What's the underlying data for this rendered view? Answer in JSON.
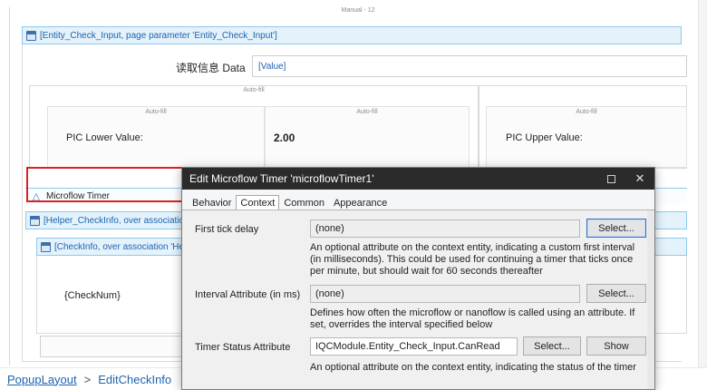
{
  "page": {
    "header": "Manual - 12",
    "dataview_title": "[Entity_Check_Input, page parameter 'Entity_Check_Input']",
    "read_info_label": "读取信息 Data",
    "read_info_value": "[Value]",
    "autofill_label": "Auto-fill",
    "pic_lower_label": "PIC Lower Value:",
    "pic_lower_value": "2.00",
    "pic_upper_label": "PIC Upper Value:",
    "timer_label": "Microflow Timer",
    "helper_dataview_title": "[Helper_CheckInfo, over association",
    "checkinfo_dataview_title": "[CheckInfo, over association 'Hel",
    "checknum": "{CheckNum}"
  },
  "breadcrumb": {
    "items": [
      "PopupLayout",
      "EditCheckInfo"
    ],
    "separator": ">"
  },
  "dialog": {
    "title": "Edit Microflow Timer 'microflowTimer1'",
    "tabs": [
      "Behavior",
      "Context",
      "Common",
      "Appearance"
    ],
    "active_tab": "Context",
    "fields": [
      {
        "label": "First tick delay",
        "value": "(none)",
        "button": "Select...",
        "help": "An optional attribute on the context entity, indicating a custom first interval (in milliseconds). This could be used for continuing a timer that ticks once per minute, but should wait for 60 seconds thereafter"
      },
      {
        "label": "Interval Attribute (in ms)",
        "value": "(none)",
        "button": "Select...",
        "help": "Defines how often the microflow or nanoflow is called using an attribute. If set, overrides the interval specified below"
      },
      {
        "label": "Timer Status Attribute",
        "value": "IQCModule.Entity_Check_Input.CanRead",
        "button": "Select...",
        "button2": "Show",
        "help": "An optional attribute on the context entity, indicating the status of the timer"
      }
    ]
  },
  "colors": {
    "accent_blue": "#1e63b0",
    "highlight_red": "#e02020",
    "title_bar": "#2b2b2b"
  }
}
